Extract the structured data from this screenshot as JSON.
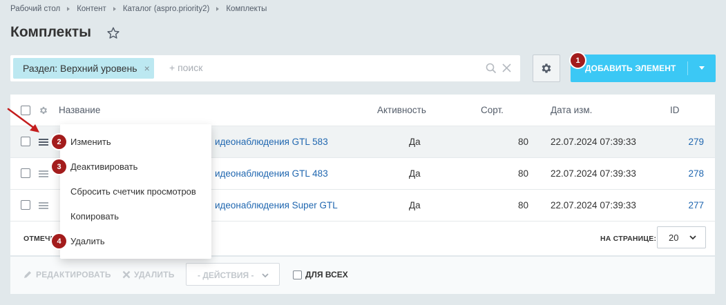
{
  "breadcrumb": [
    "Рабочий стол",
    "Контент",
    "Каталог (aspro.priority2)",
    "Комплекты"
  ],
  "page": {
    "title": "Комплекты"
  },
  "filter": {
    "tag_label": "Раздел: Верхний уровень",
    "tag_close": "×",
    "search_placeholder": "+ поиск"
  },
  "toolbar": {
    "add_label": "ДОБАВИТЬ ЭЛЕМЕНТ"
  },
  "annotations": {
    "badge1": "1",
    "badge2": "2",
    "badge3": "3",
    "badge4": "4"
  },
  "grid": {
    "columns": {
      "name": "Название",
      "active": "Активность",
      "sort": "Сорт.",
      "date": "Дата изм.",
      "id": "ID"
    },
    "rows": [
      {
        "name": "идеонаблюдения GTL 583",
        "active": "Да",
        "sort": "80",
        "date": "22.07.2024 07:39:33",
        "id": "279"
      },
      {
        "name": "идеонаблюдения GTL 483",
        "active": "Да",
        "sort": "80",
        "date": "22.07.2024 07:39:33",
        "id": "278"
      },
      {
        "name": "идеонаблюдения Super GTL",
        "active": "Да",
        "sort": "80",
        "date": "22.07.2024 07:39:33",
        "id": "277"
      }
    ],
    "footer": {
      "marked_label": "ОТМЕЧЕ",
      "per_page_label": "НА СТРАНИЦЕ:",
      "per_page_value": "20"
    }
  },
  "actions": {
    "edit": "РЕДАКТИРОВАТЬ",
    "delete": "УДАЛИТЬ",
    "select": "- ДЕЙСТВИЯ -",
    "for_all": "ДЛЯ ВСЕХ"
  },
  "context_menu": [
    "Изменить",
    "Деактивировать",
    "Сбросить счетчик просмотров",
    "Копировать",
    "Удалить"
  ],
  "colors": {
    "accent": "#3bc8f5",
    "badge": "#a31c1c",
    "link": "#2067b0",
    "tag": "#bce8f1"
  }
}
